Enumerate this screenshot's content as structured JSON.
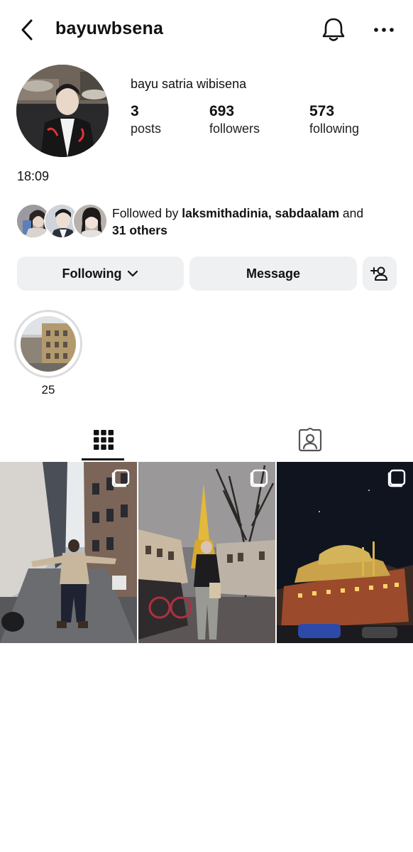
{
  "header": {
    "username": "bayuwbsena"
  },
  "profile": {
    "full_name": "bayu satria wibisena",
    "stats": [
      {
        "value": "3",
        "label": "posts"
      },
      {
        "value": "693",
        "label": "followers"
      },
      {
        "value": "573",
        "label": "following"
      }
    ],
    "bio": "18:09"
  },
  "followed_by": {
    "prefix": "Followed by ",
    "names": "laksmithadinia, sabdaalam",
    "joiner": " and",
    "others": "31 others"
  },
  "actions": {
    "following_label": "Following",
    "message_label": "Message"
  },
  "highlight": {
    "label": "25"
  },
  "tabs": {
    "active": "grid"
  },
  "icons": [
    "back-icon",
    "bell-icon",
    "more-icon",
    "chevron-down-icon",
    "add-user-icon",
    "grid-icon",
    "tagged-icon",
    "multi-post-icon"
  ]
}
